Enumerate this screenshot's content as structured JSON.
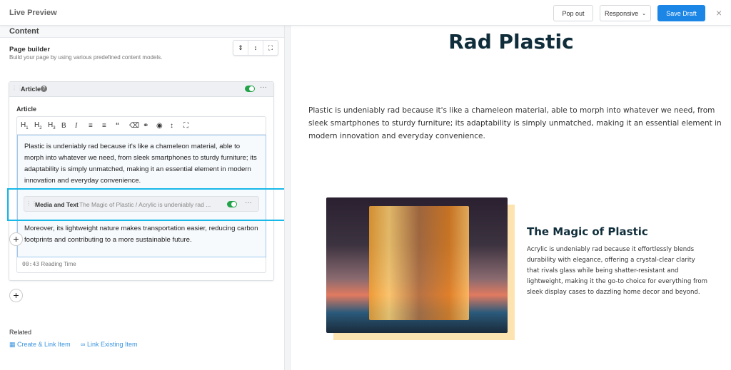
{
  "topbar": {
    "title": "Live Preview",
    "popout": "Pop out",
    "responsive": "Responsive",
    "save": "Save Draft",
    "close": "×"
  },
  "left": {
    "section": "Content",
    "page_builder": "Page builder",
    "page_builder_desc": "Build your page by using various predefined content models.",
    "article_block": {
      "title": "Article",
      "enabled": true,
      "field_label": "Article",
      "toolbar": [
        "H1",
        "H2",
        "H3",
        "B",
        "I",
        "bulleted-list",
        "numbered-list",
        "quote",
        "eraser",
        "link",
        "embed",
        "line-height",
        "fullscreen"
      ],
      "paragraph1": "Plastic is undeniably rad because it's like a chameleon material, able to morph into whatever we need, from sleek smartphones to sturdy furniture; its adaptability is simply unmatched, making it an essential element in modern innovation and everyday convenience.",
      "embedded": {
        "type": "Media and Text",
        "summary": "The Magic of Plastic / Acrylic is undeniably rad ...",
        "enabled": true
      },
      "paragraph2": "Moreover, its lightweight nature makes transportation easier, reducing carbon footprints and contributing to a more sustainable future.",
      "reading_time": "00:43",
      "reading_time_label": "Reading Time"
    },
    "related": "Related",
    "create_link": "Create & Link Item",
    "link_existing": "Link Existing Item"
  },
  "preview": {
    "title": "Rad Plastic",
    "paragraph": "Plastic is undeniably rad because it's like a chameleon material, able to morph into whatever we need, from sleek smartphones to sturdy furniture; its adaptability is simply unmatched, making it an essential element in modern innovation and everyday convenience.",
    "media_heading": "The Magic of Plastic",
    "media_text": "Acrylic is undeniably rad because it effortlessly blends durability with elegance, offering a crystal-clear clarity that rivals glass while being shatter-resistant and lightweight, making it the go-to choice for everything from sleek display cases to dazzling home decor and beyond."
  },
  "colors": {
    "accent": "#1b86e6",
    "toggle": "#22a34a",
    "highlight": "#18b8e8",
    "title": "#0f2d3a"
  }
}
